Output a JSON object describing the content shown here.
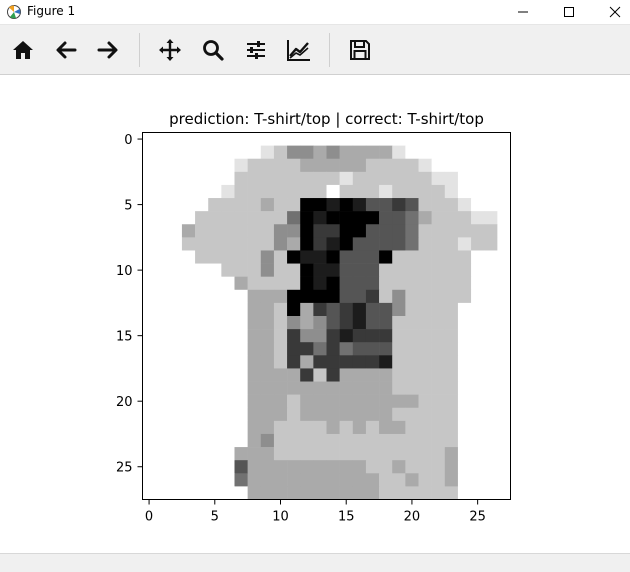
{
  "window": {
    "title": "Figure 1"
  },
  "toolbar": {
    "items": [
      "home-icon",
      "back-arrow-icon",
      "forward-arrow-icon",
      "pan-icon",
      "zoom-icon",
      "configure-subplots-icon",
      "edit-axis-icon",
      "save-icon"
    ]
  },
  "chart_data": {
    "type": "heatmap",
    "title": "prediction: T-shirt/top | correct: T-shirt/top",
    "colormap": "binary",
    "rows": 28,
    "cols": 28,
    "x_ticks": [
      "0",
      "5",
      "10",
      "15",
      "20",
      "25"
    ],
    "y_ticks": [
      "0",
      "5",
      "10",
      "15",
      "20",
      "25"
    ],
    "xlabel": "",
    "ylabel": "",
    "xlim": [
      -0.5,
      27.5
    ],
    "ylim": [
      27.5,
      -0.5
    ],
    "description_rows": [
      "0000000000000000000000000000",
      "0000000001244343333100000000",
      "0000000122223333322221000000",
      "0000000222222221222222110000",
      "0000001222222202221222210000",
      "0000022223229989866762221000",
      "0000222222259899996653222110",
      "0003222222449779966652222220",
      "0002222222439789666652221220",
      "0000222224298896669222222000",
      "0000002224229886662222222000",
      "0000000322229896662222222000",
      "0000000033399996672422222000",
      "0000000033293767866422220000",
      "0000000033243467866222220000",
      "0000000033274478777222220000",
      "0000000033277575666222220000",
      "0000000033273777778222220000",
      "0000000033337273333222220000",
      "0000000033333333333222220000",
      "0000000033323333333332220000",
      "0000000033323333333222220000",
      "0000000033222232323322220000",
      "0000000034222222222222220000",
      "0000000333222222222222230000",
      "0000000633333333322322230000",
      "0000000533333333332232230000",
      "0000000033333333332222220000"
    ]
  }
}
